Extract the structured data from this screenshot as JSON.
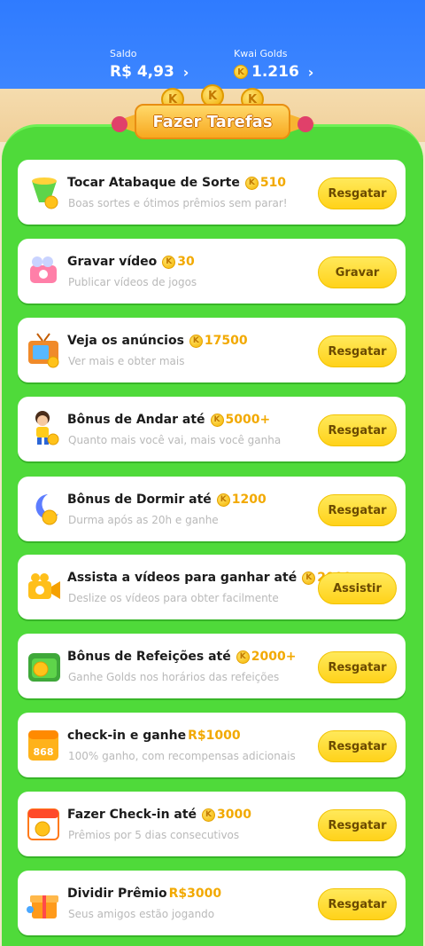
{
  "header": {
    "balance_label": "Saldo",
    "balance_value": "R$  4,93",
    "golds_label": "Kwai Golds",
    "golds_value": "1.216",
    "chevron": "›",
    "coin_letter": "K"
  },
  "banner": {
    "title": "Fazer Tarefas"
  },
  "tasks": [
    {
      "title": "Tocar Atabaque de Sorte",
      "reward": "510",
      "reward_kind": "coin",
      "subtitle": "Boas sortes e ótimos prêmios sem parar!",
      "button": "Resgatar",
      "icon": "drum-icon"
    },
    {
      "title": "Gravar vídeo",
      "reward": "30",
      "reward_kind": "coin",
      "subtitle": "Publicar vídeos de jogos",
      "button": "Gravar",
      "icon": "camera-icon"
    },
    {
      "title": "Veja os anúncios",
      "reward": "17500",
      "reward_kind": "coin",
      "subtitle": "Ver mais e obter mais",
      "button": "Resgatar",
      "icon": "tv-icon"
    },
    {
      "title": "Bônus de Andar até",
      "reward": "5000+",
      "reward_kind": "coin",
      "subtitle": "Quanto mais você vai, mais você ganha",
      "button": "Resgatar",
      "icon": "walking-boy-icon"
    },
    {
      "title": "Bônus de Dormir até",
      "reward": "1200",
      "reward_kind": "coin",
      "subtitle": "Durma após as 20h e ganhe",
      "button": "Resgatar",
      "icon": "moon-icon"
    },
    {
      "title": "Assista a vídeos para ganhar até",
      "reward": "2000",
      "reward_kind": "coin",
      "subtitle": "Deslize os vídeos para obter facilmente",
      "button": "Assistir",
      "icon": "video-camera-icon"
    },
    {
      "title": "Bônus de Refeições até",
      "reward": "2000+",
      "reward_kind": "coin",
      "subtitle": "Ganhe Golds nos horários das refeições",
      "button": "Resgatar",
      "icon": "lunchbox-icon"
    },
    {
      "title": "check-in e ganhe",
      "reward": "R$1000",
      "reward_kind": "money",
      "subtitle": "100% ganho, com recompensas adicionais",
      "button": "Resgatar",
      "icon": "calendar-868-icon"
    },
    {
      "title": "Fazer Check-in até",
      "reward": "3000",
      "reward_kind": "coin",
      "subtitle": "Prêmios por 5 dias consecutivos",
      "button": "Resgatar",
      "icon": "calendar-coin-icon"
    },
    {
      "title": "Dividir Prêmio",
      "reward": "R$3000",
      "reward_kind": "money",
      "subtitle": "Seus amigos estão jogando",
      "button": "Resgatar",
      "icon": "gift-icon"
    }
  ],
  "calendar_text": "868",
  "colors": {
    "header_blue": "#3d86ff",
    "panel_green": "#4fda3a",
    "button_yellow": "#ffd21a",
    "reward_gold": "#f2a900"
  }
}
